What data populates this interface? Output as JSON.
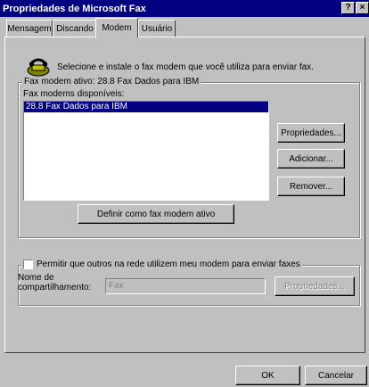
{
  "window": {
    "title": "Propriedades de Microsoft Fax",
    "help_button": "?",
    "close_button": "×"
  },
  "tabs": [
    {
      "label": "Mensagem",
      "active": false
    },
    {
      "label": "Discando",
      "active": false
    },
    {
      "label": "Modem",
      "active": true
    },
    {
      "label": "Usuário",
      "active": false
    }
  ],
  "modem_tab": {
    "description": "Selecione e instale o fax modem que você utiliza para enviar fax.",
    "active_modem_group": {
      "legend": "Fax modem ativo: 28.8 Fax Dados para IBM",
      "available_label": "Fax modems disponíveis:",
      "modems": [
        "28.8 Fax Dados para IBM"
      ],
      "selected_index": 0,
      "properties_button": "Propriedades...",
      "add_button": "Adicionar...",
      "remove_button": "Remover...",
      "set_active_button": "Definir como fax modem ativo"
    },
    "sharing_group": {
      "checkbox_label": "Permitir que outros na rede utilizem meu modem para enviar faxes",
      "checked": false,
      "share_name_label": "Nome de compartilhamento:",
      "share_name_value": "Fax",
      "share_properties_button": "Propriedades..."
    }
  },
  "footer": {
    "ok_button": "OK",
    "cancel_button": "Cancelar"
  }
}
